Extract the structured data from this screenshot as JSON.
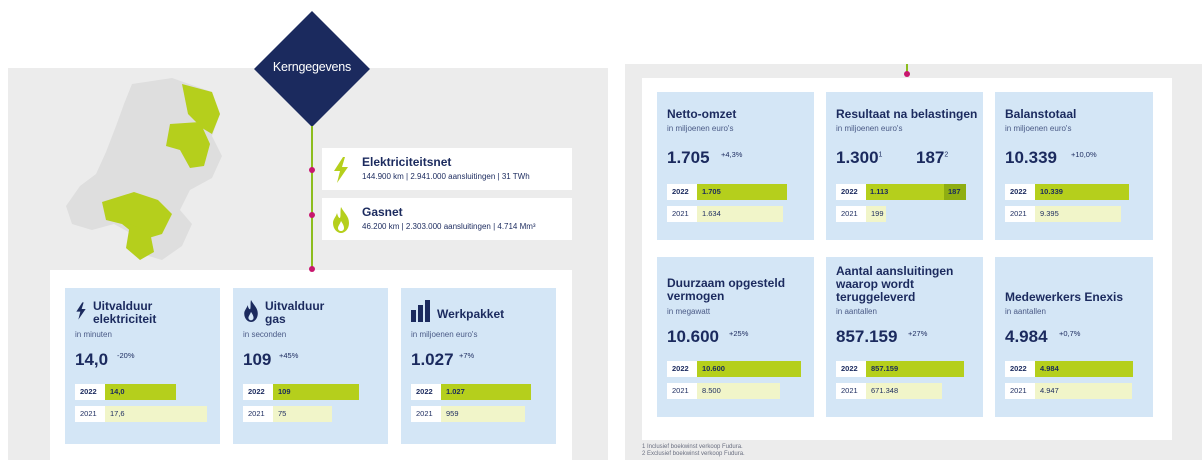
{
  "header": {
    "title": "Kerngegevens"
  },
  "networks": [
    {
      "title": "Elektriciteitsnet",
      "detail": "144.900 km | 2.941.000 aansluitingen | 31 TWh",
      "icon": "lightning-icon"
    },
    {
      "title": "Gasnet",
      "detail": "46.200 km | 2.303.000 aansluitingen | 4.714 Mm³",
      "icon": "flame-icon"
    }
  ],
  "left_cards": [
    {
      "title": "Uitvalduur elektriciteit",
      "unit": "in minuten",
      "value": "14,0",
      "change": "-20%",
      "y2022_label": "2022",
      "y2022": "14,0",
      "y2021_label": "2021",
      "y2021": "17,6",
      "icon": "lightning-icon",
      "fill2022": 0.86,
      "fill2021": 1.0
    },
    {
      "title": "Uitvalduur gas",
      "unit": "in seconden",
      "value": "109",
      "change": "+45%",
      "y2022_label": "2022",
      "y2022": "109",
      "y2021_label": "2021",
      "y2021": "75",
      "icon": "flame-icon",
      "fill2022": 1.0,
      "fill2021": 0.69
    },
    {
      "title": "Werkpakket",
      "unit": "in miljoenen euro's",
      "value": "1.027",
      "change": "+7%",
      "y2022_label": "2022",
      "y2022": "1.027",
      "y2021_label": "2021",
      "y2021": "959",
      "icon": "bar-chart-icon",
      "fill2022": 1.0,
      "fill2021": 0.93
    }
  ],
  "right_cards": [
    {
      "title": "Netto-omzet",
      "unit": "in miljoenen euro's",
      "value": "1.705",
      "change": "+4,3%",
      "y2022_label": "2022",
      "y2022": "1.705",
      "y2021_label": "2021",
      "y2021": "1.634",
      "fill2022": 1.0,
      "fill2021": 0.96
    },
    {
      "title": "Resultaat na belastingen",
      "unit": "in miljoenen euro's",
      "value": "1.300",
      "value_sup": "1",
      "value2": "187",
      "value2_sup": "2",
      "y2022_label": "2022",
      "y2022": "1.113",
      "y2022_b": "187",
      "y2021_label": "2021",
      "y2021": "199",
      "fill2021": 0.18
    },
    {
      "title": "Balanstotaal",
      "unit": "in miljoenen euro's",
      "value": "10.339",
      "change": "+10,0%",
      "y2022_label": "2022",
      "y2022": "10.339",
      "y2021_label": "2021",
      "y2021": "9.395",
      "fill2022": 1.0,
      "fill2021": 0.91
    },
    {
      "title": "Duurzaam opgesteld vermogen",
      "unit": "in megawatt",
      "value": "10.600",
      "change": "+25%",
      "y2022_label": "2022",
      "y2022": "10.600",
      "y2021_label": "2021",
      "y2021": "8.500",
      "fill2022": 1.0,
      "fill2021": 0.8
    },
    {
      "title": "Aantal aansluitingen waarop wordt teruggeleverd",
      "unit": "in aantallen",
      "value": "857.159",
      "change": "+27%",
      "y2022_label": "2022",
      "y2022": "857.159",
      "y2021_label": "2021",
      "y2021": "671.348",
      "fill2022": 1.0,
      "fill2021": 0.78
    },
    {
      "title": "Medewerkers Enexis",
      "unit": "in aantallen",
      "value": "4.984",
      "change": "+0,7%",
      "y2022_label": "2022",
      "y2022": "4.984",
      "y2021_label": "2021",
      "y2021": "4.947",
      "fill2022": 1.0,
      "fill2021": 0.99
    }
  ],
  "footnotes": [
    "1   Inclusief boekwinst verkoop Fudura.",
    "2   Exclusief boekwinst verkoop Fudura."
  ],
  "colors": {
    "navy": "#1b2a5e",
    "lime": "#b5cf1c",
    "light_lime": "#f1f5c9",
    "card_blue": "#d4e6f6",
    "magenta": "#c8176e"
  }
}
